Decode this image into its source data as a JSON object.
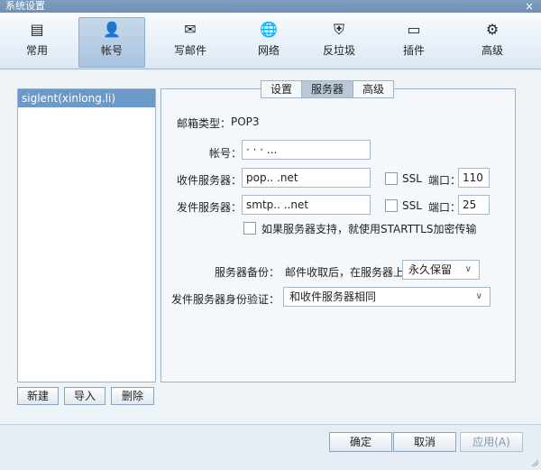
{
  "window": {
    "title": "系统设置",
    "close_glyph": "×"
  },
  "toolbar": {
    "items": [
      {
        "label": "常用",
        "icon": "general-icon",
        "glyph": "▤"
      },
      {
        "label": "帐号",
        "icon": "account-icon",
        "glyph": "👤"
      },
      {
        "label": "写邮件",
        "icon": "compose-icon",
        "glyph": "✉"
      },
      {
        "label": "网络",
        "icon": "network-icon",
        "glyph": "🌐"
      },
      {
        "label": "反垃圾",
        "icon": "shield-icon",
        "glyph": "⛨"
      },
      {
        "label": "插件",
        "icon": "plugin-icon",
        "glyph": "▭"
      },
      {
        "label": "高级",
        "icon": "gear-icon",
        "glyph": "⚙"
      }
    ],
    "active_index": 1
  },
  "accounts": {
    "items": [
      "siglent(xinlong.li)"
    ],
    "selected": 0
  },
  "left_buttons": {
    "new": "新建",
    "import": "导入",
    "delete": "删除"
  },
  "tabs": {
    "items": [
      "设置",
      "服务器",
      "高级"
    ],
    "active_index": 1
  },
  "form": {
    "mailbox_type_label": "邮箱类型：",
    "mailbox_type_value": "POP3",
    "account_label": "帐号：",
    "account_value": "· · ·               ...",
    "incoming_label": "收件服务器：",
    "incoming_value": "pop..     .net",
    "outgoing_label": "发件服务器：",
    "outgoing_value": "smtp..    ..net",
    "ssl_label": "SSL",
    "port_label": "端口：",
    "incoming_port": "110",
    "outgoing_port": "25",
    "starttls_label": "如果服务器支持，就使用STARTTLS加密传输",
    "backup_label": "服务器备份：",
    "backup_text": "邮件收取后，在服务器上",
    "backup_option": "永久保留",
    "auth_label": "发件服务器身份验证：",
    "auth_option": "和收件服务器相同"
  },
  "footer": {
    "ok": "确定",
    "cancel": "取消",
    "apply": "应用(A)"
  },
  "colors": {
    "accent": "#6b9ac8",
    "titlebar": "#6d8fb4"
  }
}
